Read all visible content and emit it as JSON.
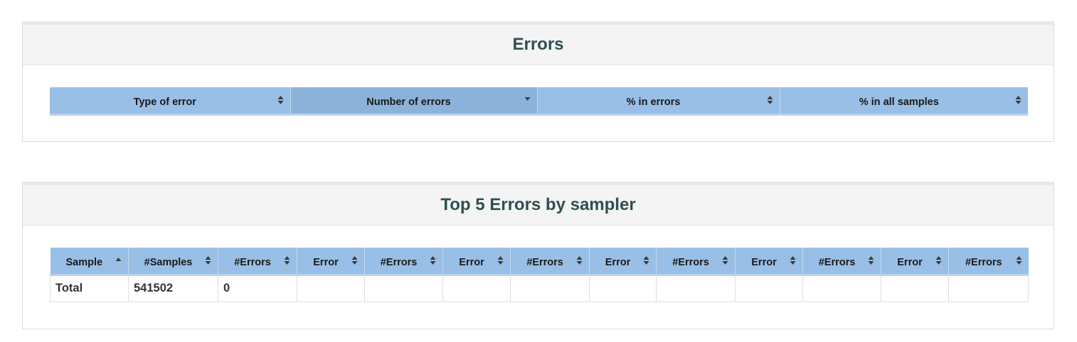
{
  "errors_panel": {
    "title": "Errors",
    "columns": [
      {
        "label": "Type of error",
        "sort": "both"
      },
      {
        "label": "Number of errors",
        "sort": "desc"
      },
      {
        "label": "% in errors",
        "sort": "both"
      },
      {
        "label": "% in all samples",
        "sort": "both"
      }
    ]
  },
  "top5_panel": {
    "title": "Top 5 Errors by sampler",
    "columns": [
      {
        "label": "Sample",
        "sort": "asc"
      },
      {
        "label": "#Samples",
        "sort": "both"
      },
      {
        "label": "#Errors",
        "sort": "both"
      },
      {
        "label": "Error",
        "sort": "both"
      },
      {
        "label": "#Errors",
        "sort": "both"
      },
      {
        "label": "Error",
        "sort": "both"
      },
      {
        "label": "#Errors",
        "sort": "both"
      },
      {
        "label": "Error",
        "sort": "both"
      },
      {
        "label": "#Errors",
        "sort": "both"
      },
      {
        "label": "Error",
        "sort": "both"
      },
      {
        "label": "#Errors",
        "sort": "both"
      },
      {
        "label": "Error",
        "sort": "both"
      },
      {
        "label": "#Errors",
        "sort": "both"
      }
    ],
    "rows": [
      [
        "Total",
        "541502",
        "0",
        "",
        "",
        "",
        "",
        "",
        "",
        "",
        "",
        "",
        ""
      ]
    ]
  },
  "colors": {
    "header_bg": "#99bfe6",
    "header_sorted_bg": "#8db2da",
    "title": "#2f4f4f",
    "panel_heading_bg": "#f4f4f4"
  }
}
